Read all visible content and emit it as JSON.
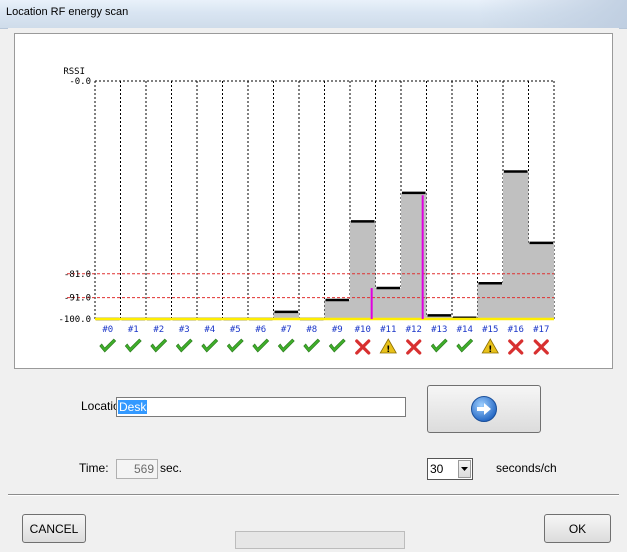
{
  "window": {
    "title": "Location RF energy scan"
  },
  "chart_data": {
    "type": "bar",
    "ylabel": "RSSI",
    "ylim": [
      -100.0,
      0.0
    ],
    "y_tick_labels": [
      "-0.0",
      "-81.0",
      "-91.0",
      "-100.0"
    ],
    "threshold_lines": [
      -81.0,
      -91.0
    ],
    "categories": [
      "#0",
      "#1",
      "#2",
      "#3",
      "#4",
      "#5",
      "#6",
      "#7",
      "#8",
      "#9",
      "#10",
      "#11",
      "#12",
      "#13",
      "#14",
      "#15",
      "#16",
      "#17"
    ],
    "values": [
      -100,
      -100,
      -100,
      -100,
      -100,
      -100,
      -100,
      -97,
      -100,
      -92,
      -59,
      -87,
      -47,
      -98.5,
      -99.5,
      -85,
      -38,
      -68
    ],
    "markers": [
      {
        "channel": 10,
        "from": -100,
        "to": -87
      },
      {
        "channel": 12,
        "from": -100,
        "to": -48
      }
    ],
    "statuses": [
      "ok",
      "ok",
      "ok",
      "ok",
      "ok",
      "ok",
      "ok",
      "ok",
      "ok",
      "ok",
      "bad",
      "warn",
      "bad",
      "ok",
      "ok",
      "warn",
      "bad",
      "bad"
    ],
    "colors": {
      "bar": "#c0c0c0",
      "bar_top": "#000000",
      "marker": "#e000e0",
      "threshold": "#e03030",
      "baseline": "#ffee00",
      "ok": "#3fae2a",
      "bad": "#d83030",
      "warn": "#e8c11a"
    }
  },
  "form": {
    "location_label": "Location:",
    "location_value": "Desk",
    "time_label": "Time:",
    "time_value": "569",
    "time_unit": "sec.",
    "seconds_value": "30",
    "seconds_unit": "seconds/ch",
    "go_icon": "arrow-right-circle-icon"
  },
  "footer": {
    "cancel_label": "CANCEL",
    "ok_label": "OK"
  }
}
